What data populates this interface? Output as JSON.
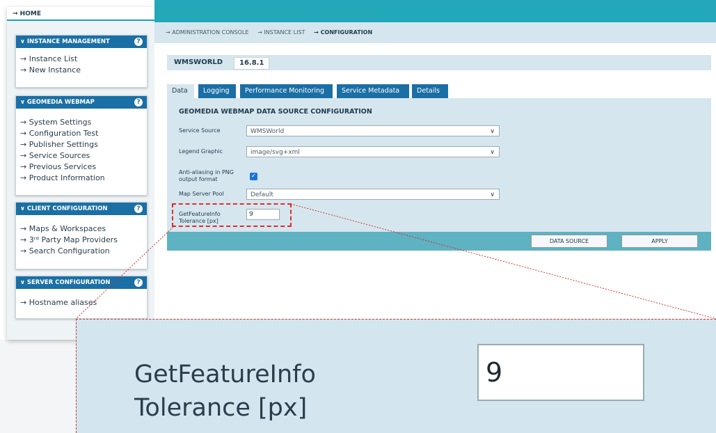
{
  "sidebar": {
    "home": "→ HOME",
    "panels": [
      {
        "title": "∨ INSTANCE MANAGEMENT",
        "items": [
          "→ Instance List",
          "→ New Instance"
        ]
      },
      {
        "title": "∨ GEOMEDIA WEBMAP",
        "items": [
          "→ System Settings",
          "→ Configuration Test",
          "→ Publisher Settings",
          "→ Service Sources",
          "→ Previous Services",
          "→ Product Information"
        ]
      },
      {
        "title": "∨ CLIENT CONFIGURATION",
        "items": [
          "→ Maps & Workspaces",
          "→ 3ʳᵈ Party Map Providers",
          "→ Search Configuration"
        ]
      },
      {
        "title": "∨ SERVER CONFIGURATION",
        "items": [
          "→ Hostname aliases"
        ]
      }
    ],
    "help_glyph": "?"
  },
  "breadcrumb": {
    "items": [
      "→ ADMINISTRATION CONSOLE",
      "→ INSTANCE LIST",
      "→ CONFIGURATION"
    ]
  },
  "instance": {
    "name": "WMSWORLD",
    "version": "16.8.1"
  },
  "tabs": [
    "Data",
    "Logging",
    "Performance Monitoring",
    "Service Metadata",
    "Details"
  ],
  "form": {
    "title": "GEOMEDIA WEBMAP DATA SOURCE CONFIGURATION",
    "service_source": {
      "label": "Service Source",
      "value": "WMSWorld"
    },
    "legend_graphic": {
      "label": "Legend Graphic",
      "value": "image/svg+xml"
    },
    "anti_aliasing": {
      "label_line1": "Anti-aliasing in PNG",
      "label_line2": "output format",
      "checked": true,
      "check_glyph": "✓"
    },
    "map_server_pool": {
      "label": "Map Server Pool",
      "value": "Default"
    },
    "tolerance": {
      "label_line1": "GetFeatureInfo",
      "label_line2": "Tolerance [px]",
      "value": "9"
    },
    "chevron_glyph": "∨"
  },
  "buttons": {
    "data_source": "DATA SOURCE",
    "apply": "APPLY"
  },
  "zoom": {
    "label_line1": "GetFeatureInfo",
    "label_line2": "Tolerance [px]",
    "value": "9"
  },
  "colors": {
    "accent": "#22a8b8",
    "panel_header": "#1a6fa5",
    "highlight": "#e02a2a"
  }
}
